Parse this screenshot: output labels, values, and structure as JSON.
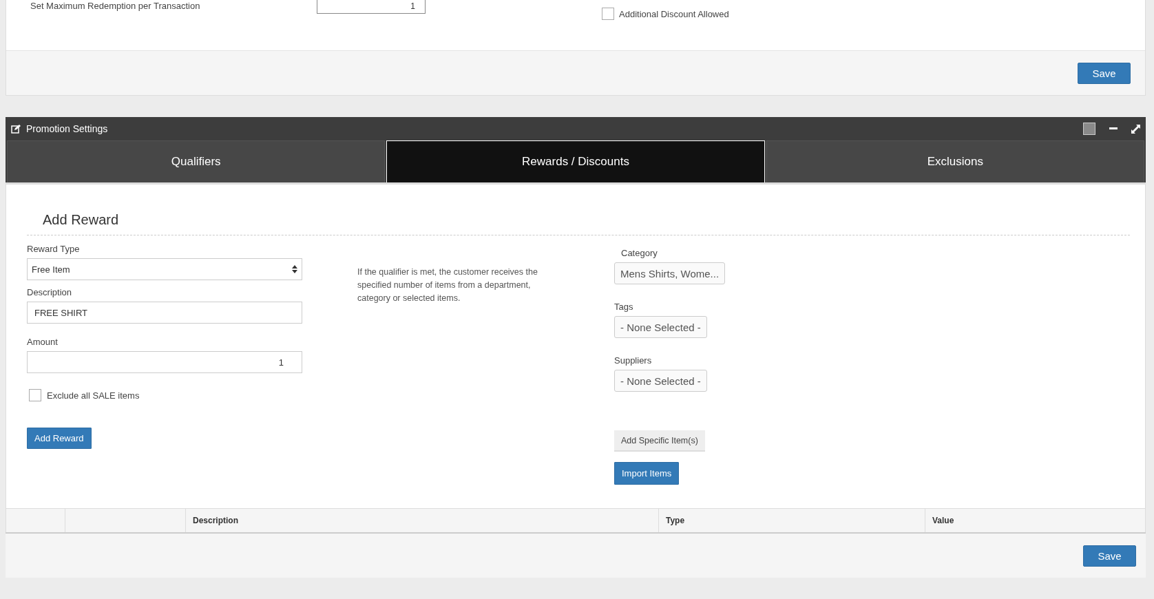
{
  "top_section": {
    "max_redemption": {
      "label": "Set Maximum Redemption per Transaction",
      "value": "1"
    },
    "additional_discount": {
      "label": "Additional Discount Allowed",
      "checked": false
    },
    "save_button": "Save"
  },
  "promotion_settings": {
    "title": "Promotion Settings",
    "tabs": [
      {
        "label": "Qualifiers",
        "selected": false
      },
      {
        "label": "Rewards / Discounts",
        "selected": true
      },
      {
        "label": "Exclusions",
        "selected": false
      }
    ],
    "add_reward": {
      "heading": "Add Reward",
      "reward_type": {
        "label": "Reward Type",
        "value": "Free Item"
      },
      "description": {
        "label": "Description",
        "value": "FREE SHIRT"
      },
      "amount": {
        "label": "Amount",
        "value": "1"
      },
      "exclude_sale": {
        "label": "Exclude all SALE items",
        "checked": false
      },
      "add_button": "Add Reward",
      "help_text": "If the qualifier is met, the customer receives the specified number of items from a department, category or selected items.",
      "category": {
        "label": "Category",
        "value": "Mens Shirts, Wome..."
      },
      "tags": {
        "label": "Tags",
        "value": "- None Selected -"
      },
      "suppliers": {
        "label": "Suppliers",
        "value": "- None Selected -"
      },
      "add_specific_button": "Add Specific Item(s)",
      "import_button": "Import Items"
    },
    "table": {
      "columns": [
        "",
        "",
        "Description",
        "Type",
        "Value"
      ]
    },
    "save_button": "Save"
  }
}
